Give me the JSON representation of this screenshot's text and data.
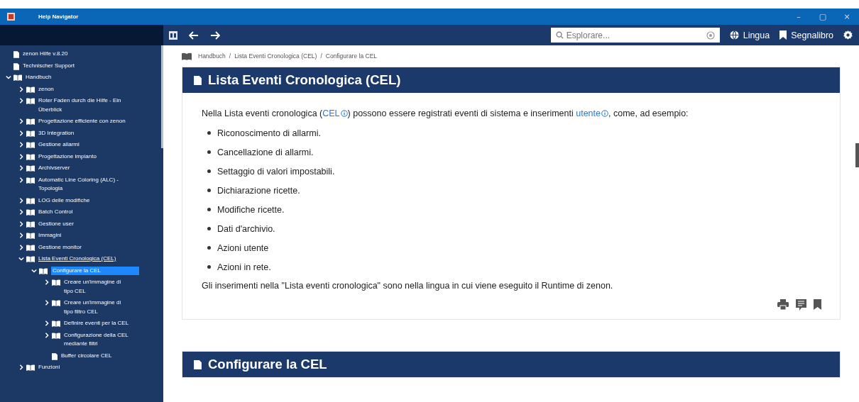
{
  "window": {
    "title": "Help Navigator",
    "controls": [
      "–",
      "▢",
      "×"
    ]
  },
  "toolbar": {
    "search": {
      "placeholder": "Esplorare..."
    },
    "language": "Lingua",
    "bookmarks": "Segnalibro"
  },
  "tree": [
    {
      "label": "zenon Hilfe v.8.20",
      "kind": "page",
      "selected": false,
      "underlined": false
    },
    {
      "label": "Technischer Support",
      "kind": "page",
      "selected": false,
      "underlined": false
    },
    {
      "label": "Handbuch",
      "kind": "book",
      "expanded": true,
      "selected": false,
      "underlined": false,
      "children": [
        {
          "label": "zenon",
          "kind": "book",
          "expanded": false,
          "selected": false,
          "underlined": false
        },
        {
          "label": "Roter Faden durch die Hilfe - Ein Überblick",
          "kind": "book",
          "expanded": false,
          "selected": false,
          "underlined": false
        },
        {
          "label": "Progettazione efficiente con zenon",
          "kind": "book",
          "expanded": false,
          "selected": false,
          "underlined": false
        },
        {
          "label": "3D Integration",
          "kind": "book",
          "expanded": false,
          "selected": false,
          "underlined": false
        },
        {
          "label": "Gestione allarmi",
          "kind": "book",
          "expanded": false,
          "selected": false,
          "underlined": false
        },
        {
          "label": "Progettazione impianto",
          "kind": "book",
          "expanded": false,
          "selected": false,
          "underlined": false
        },
        {
          "label": "Archivserver",
          "kind": "book",
          "expanded": false,
          "selected": false,
          "underlined": false
        },
        {
          "label": "Automatic Line Coloring (ALC) - Topologia",
          "kind": "book",
          "expanded": false,
          "selected": false,
          "underlined": false
        },
        {
          "label": "LOG delle modifiche",
          "kind": "book",
          "expanded": false,
          "selected": false,
          "underlined": false
        },
        {
          "label": "Batch Control",
          "kind": "book",
          "expanded": false,
          "selected": false,
          "underlined": false
        },
        {
          "label": "Gestione user",
          "kind": "book",
          "expanded": false,
          "selected": false,
          "underlined": false
        },
        {
          "label": "Immagini",
          "kind": "book",
          "expanded": false,
          "selected": false,
          "underlined": false
        },
        {
          "label": "Gestione monitor",
          "kind": "book",
          "expanded": false,
          "selected": false,
          "underlined": false
        },
        {
          "label": "Lista Eventi Cronologica (CEL)",
          "kind": "book",
          "expanded": true,
          "selected": false,
          "underlined": true,
          "children": [
            {
              "label": "Configurare la CEL",
              "kind": "book",
              "expanded": true,
              "selected": true,
              "underlined": false,
              "children": [
                {
                  "label": "Creare un'immagine di tipo CEL",
                  "kind": "book",
                  "expanded": false,
                  "selected": false,
                  "underlined": false
                },
                {
                  "label": "Creare un'immagine di tipo filtro CEL",
                  "kind": "book",
                  "expanded": false,
                  "selected": false,
                  "underlined": false
                },
                {
                  "label": "Definire eventi per la CEL",
                  "kind": "book",
                  "expanded": false,
                  "selected": false,
                  "underlined": false
                },
                {
                  "label": "Configurazione della CEL mediante filtri",
                  "kind": "book",
                  "expanded": false,
                  "selected": false,
                  "underlined": false
                },
                {
                  "label": "Buffer circolare CEL",
                  "kind": "page",
                  "selected": false,
                  "underlined": false
                }
              ]
            }
          ]
        },
        {
          "label": "Funzioni",
          "kind": "book",
          "expanded": false,
          "selected": false,
          "underlined": false
        }
      ]
    }
  ],
  "breadcrumb": {
    "items": [
      "Handbuch",
      "Lista Eventi Cronologica (CEL)",
      "Configurare la CEL"
    ],
    "separator": "/"
  },
  "articles": [
    {
      "title": "Lista Eventi Cronologica (CEL)",
      "intro": [
        {
          "kind": "text",
          "text": "Nella Lista eventi cronologica ("
        },
        {
          "kind": "link",
          "text": "CEL"
        },
        {
          "kind": "text",
          "text": ") possono essere registrati eventi di sistema e inserimenti "
        },
        {
          "kind": "link",
          "text": "utente"
        },
        {
          "kind": "text",
          "text": ", come, ad esempio:"
        }
      ],
      "bullets": [
        "Riconoscimento di allarmi.",
        "Cancellazione di allarmi.",
        "Settaggio di valori impostabili.",
        "Dichiarazione ricette.",
        "Modifiche ricette.",
        "Dati d'archivio.",
        "Azioni utente",
        "Azioni in rete."
      ],
      "closing": "Gli inserimenti nella \"Lista eventi cronologica\" sono nella lingua in cui viene eseguito il Runtime di zenon."
    },
    {
      "title": "Configurare la CEL"
    }
  ]
}
